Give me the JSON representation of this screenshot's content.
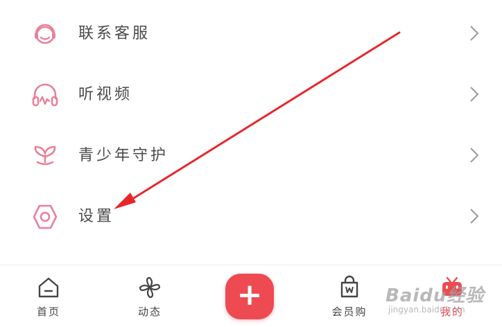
{
  "menu": {
    "items": [
      {
        "label": "联系客服",
        "icon": "headset-icon"
      },
      {
        "label": "听视频",
        "icon": "headphones-icon"
      },
      {
        "label": "青少年守护",
        "icon": "sprout-icon"
      },
      {
        "label": "设置",
        "icon": "hexagon-gear-icon"
      }
    ]
  },
  "tabbar": {
    "tabs": [
      {
        "label": "首页",
        "icon": "home-icon"
      },
      {
        "label": "动态",
        "icon": "pinwheel-icon"
      },
      {
        "label": "+",
        "icon": "plus-icon"
      },
      {
        "label": "会员购",
        "icon": "shopping-bag-icon"
      },
      {
        "label": "我的",
        "icon": "tv-icon"
      }
    ]
  },
  "watermark": {
    "main": "Baidu经验",
    "sub": "jingyan.baidu.com"
  },
  "colors": {
    "accent_pink": "#e9809a",
    "plus_red": "#ee4a52",
    "arrow_red": "#e8262a",
    "text": "#4a4a4a"
  }
}
